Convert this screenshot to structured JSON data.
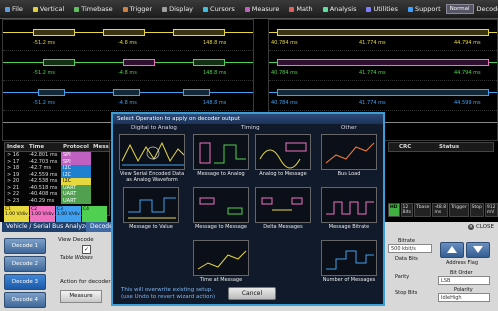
{
  "menubar": {
    "items": [
      {
        "label": "File",
        "color": "#5aa0e0"
      },
      {
        "label": "Vertical",
        "color": "#e0d040"
      },
      {
        "label": "Timebase",
        "color": "#60c060"
      },
      {
        "label": "Trigger",
        "color": "#d08040"
      },
      {
        "label": "Display",
        "color": "#a0a0a0"
      },
      {
        "label": "Cursors",
        "color": "#40c0e0"
      },
      {
        "label": "Measure",
        "color": "#c060c0"
      },
      {
        "label": "Math",
        "color": "#e06060"
      },
      {
        "label": "Analysis",
        "color": "#60e0a0"
      },
      {
        "label": "Utilities",
        "color": "#8080ff"
      },
      {
        "label": "Support",
        "color": "#40a0ff"
      }
    ],
    "mode_label": "Normal",
    "decode_label": "Decode"
  },
  "plots": {
    "left_times": {
      "row1": [
        "-51.2 ms",
        "-4.8 ms",
        "148.8 ms"
      ],
      "row2": [
        "-51.2 ms",
        "-4.8 ms",
        "148.8 ms"
      ],
      "row3": [
        "-51.2 ms",
        "-4.8 ms",
        "148.8 ms"
      ]
    },
    "right_times": {
      "row1": [
        "40.784 ms",
        "41.774 ms",
        "44.794 ms"
      ],
      "row2": [
        "40.784 ms",
        "41.774 ms",
        "44.794 ms"
      ],
      "row3": [
        "40.784 ms",
        "41.774 ms",
        "44.599 ms"
      ]
    }
  },
  "table": {
    "headers": [
      "Index",
      "Time",
      "Protocol",
      "Mess"
    ],
    "rows": [
      {
        "index": "> 16",
        "time": "-42.801 ms",
        "protocol": "SPI"
      },
      {
        "index": "> 17",
        "time": "-42.703 ms",
        "protocol": "SPI"
      },
      {
        "index": "> 18",
        "time": "-42.7 ms",
        "protocol": "I2C"
      },
      {
        "index": "> 19",
        "time": "-42.559 ms",
        "protocol": "I2C"
      },
      {
        "index": "> 20",
        "time": "-42.538 ms",
        "protocol": "I2C"
      },
      {
        "index": "> 21",
        "time": "-40.518 ms",
        "protocol": "UART"
      },
      {
        "index": "> 22",
        "time": "-40.408 ms",
        "protocol": "UART"
      },
      {
        "index": "> 23",
        "time": "-40.29 ms",
        "protocol": "UART"
      }
    ],
    "right_headers": [
      "CRC",
      "Status"
    ]
  },
  "channels": [
    {
      "name": "C1",
      "v1": "1.00 V/div",
      "v2": "2.3700 V",
      "color": "#e8d840"
    },
    {
      "name": "C2",
      "v1": "1.00 V/div",
      "v2": "-3.5500 V",
      "color": "#f070c0"
    },
    {
      "name": "C3",
      "v1": "1.00 V/div",
      "v2": "-3.3700 V",
      "color": "#40a0f0"
    },
    {
      "name": "C4",
      "v1": "",
      "v2": "",
      "color": "#50d050"
    }
  ],
  "status": {
    "hd": "HD",
    "tbase_label": "Tbase",
    "tbase_val": "-48.8 ms",
    "trigger_label": "Trigger",
    "bits": "12 Bits",
    "ms": "10 MS",
    "rate": "100 MS/s",
    "stop": "Stop",
    "spi": "SPI",
    "val": "912 mV"
  },
  "bottom": {
    "tab_label": "Vehicle / Serial Bus Analyzer",
    "tab2_label": "Decode",
    "close_label": "CLOSE",
    "decode_buttons": [
      "Decode 1",
      "Decode 2",
      "Decode 3",
      "Decode 4"
    ],
    "view_decode_label": "View Decode",
    "table_wdows_label": "Table Wdows",
    "action_label": "Action for decoder",
    "measure_label": "Measure",
    "bitrate_label": "Bitrate",
    "bitrate_val": "500 kbit/s",
    "data_bits_label": "Data Bits",
    "parity_label": "Parity",
    "stop_bits_label": "Stop Bits",
    "address_flag_label": "Address Flag",
    "bit_order_label": "Bit Order",
    "bit_order_val": "LSB",
    "polarity_label": "Polarity",
    "polarity_val": "IdleHigh"
  },
  "dialog": {
    "title": "Select Operation to apply on decoder output",
    "categories": [
      "Digital to Analog",
      "Timing",
      "Other"
    ],
    "options": [
      "View Serial Encoded Data as Analog Waveform",
      "Message to Analog",
      "Analog to Message",
      "Bus Load",
      "Message to Value",
      "Message to Message",
      "Delta Messages",
      "Message Bitrate",
      "Time at Message",
      "Number of Messages"
    ],
    "note_line1": "This will overwrite existing setup.",
    "note_line2": "(use Undo to revert wizard action)",
    "cancel_label": "Cancel"
  }
}
